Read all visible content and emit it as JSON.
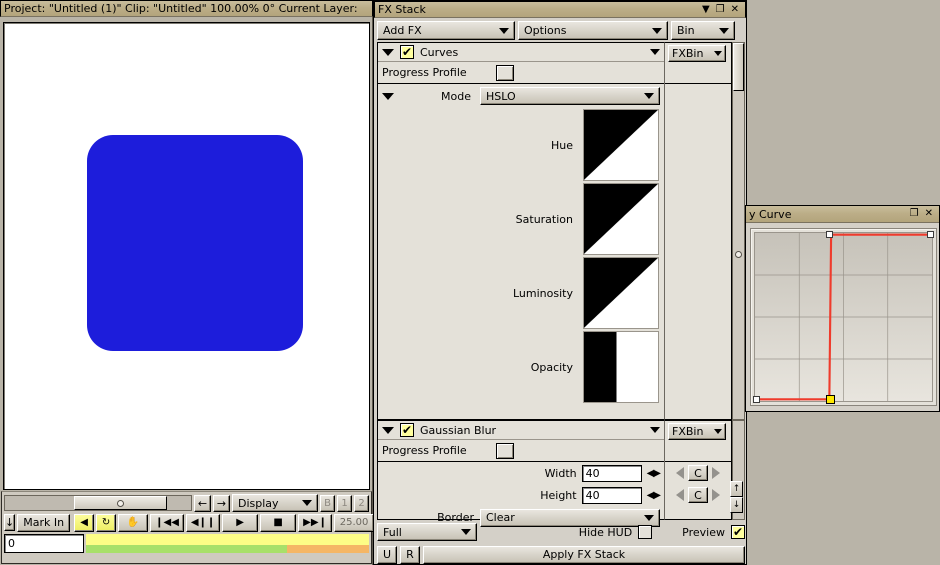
{
  "viewer": {
    "title": "Project: \"Untitled (1)\"  Clip: \"Untitled\"   100.00%   0°  Current Layer:",
    "display_dropdown": "Display",
    "small_buttons": [
      "B",
      "1",
      "2"
    ],
    "mark_in": "Mark In",
    "fps": "25.00",
    "timecode": "0",
    "transport": {
      "audio": "◀",
      "loop": "↻",
      "hand": "✋",
      "start": "❙◀◀",
      "step_back": "◀❙❙",
      "play": "▶",
      "stop": "■",
      "end": "▶▶❙"
    },
    "square_color": "#1d1ddb",
    "canvas_color": "#ffffff",
    "bar_colors": {
      "top": "#fdfd86",
      "green": "#a8e06a",
      "orange": "#f5b665"
    }
  },
  "fx_stack": {
    "title": "FX Stack",
    "window_buttons": {
      "minimize": "▼",
      "restore": "❐",
      "close": "✕"
    },
    "toolbar": {
      "add_fx": "Add FX",
      "options": "Options",
      "bin": "Bin"
    },
    "effects": [
      {
        "name": "Curves",
        "enabled_mark": "✔",
        "fxbin_label": "FXBin",
        "progress_profile_label": "Progress Profile",
        "mode_label": "Mode",
        "mode_value": "HSLO",
        "channels": [
          {
            "label": "Hue",
            "thumb": "ramp"
          },
          {
            "label": "Saturation",
            "thumb": "ramp"
          },
          {
            "label": "Luminosity",
            "thumb": "ramp"
          },
          {
            "label": "Opacity",
            "thumb": "step"
          }
        ]
      },
      {
        "name": "Gaussian Blur",
        "enabled_mark": "✔",
        "fxbin_label": "FXBin",
        "progress_profile_label": "Progress Profile",
        "params": [
          {
            "label": "Width",
            "value": "40",
            "keyframe_button": "C"
          },
          {
            "label": "Height",
            "value": "40",
            "keyframe_button": "C"
          }
        ],
        "border_label": "Border",
        "border_value": "Clear"
      }
    ],
    "footer": {
      "quality": "Full",
      "hide_hud_label": "Hide HUD",
      "hide_hud_checked": false,
      "preview_label": "Preview",
      "preview_checked": true,
      "preview_mark": "✔",
      "undo": "U",
      "redo": "R",
      "apply": "Apply FX Stack"
    },
    "accent_check_color": "#ffff9e"
  },
  "curve_window": {
    "title": "y Curve",
    "window_buttons": {
      "restore": "❐",
      "close": "✕"
    },
    "curve_color": "#ef3b2c",
    "grid_cols": 4,
    "grid_rows": 4,
    "points": [
      {
        "x": 0.0,
        "y": 0.0,
        "selected": false
      },
      {
        "x": 0.42,
        "y": 0.0,
        "selected": true
      },
      {
        "x": 0.43,
        "y": 1.0,
        "selected": false
      },
      {
        "x": 1.0,
        "y": 1.0,
        "selected": false
      }
    ]
  }
}
